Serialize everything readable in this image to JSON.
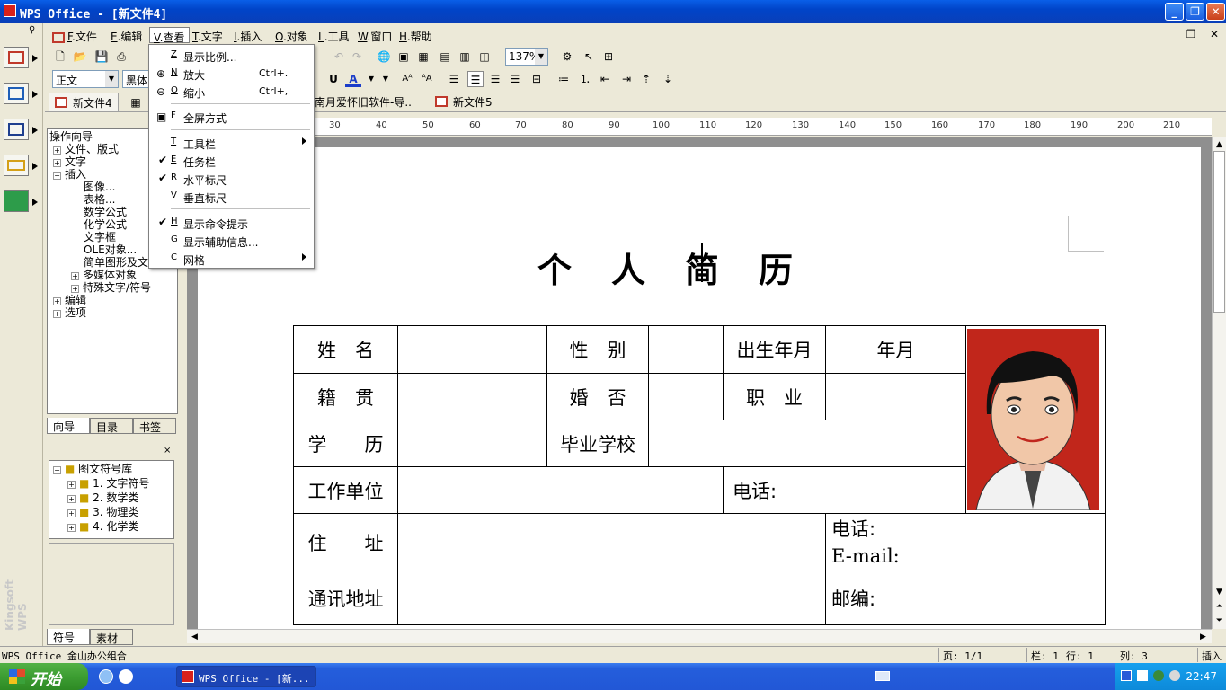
{
  "window": {
    "title": "WPS Office - [新文件4]",
    "minimize": "_",
    "maximize": "❐",
    "close": "✕"
  },
  "menubar": {
    "items": [
      {
        "key": "F",
        "label": "文件"
      },
      {
        "key": "E",
        "label": "编辑"
      },
      {
        "key": "V",
        "label": "查看"
      },
      {
        "key": "T",
        "label": "文字"
      },
      {
        "key": "I",
        "label": "插入"
      },
      {
        "key": "O",
        "label": "对象"
      },
      {
        "key": "L",
        "label": "工具"
      },
      {
        "key": "W",
        "label": "窗口"
      },
      {
        "key": "H",
        "label": "帮助"
      }
    ],
    "mdi": {
      "min": "_",
      "restore": "❐",
      "close": "✕"
    }
  },
  "toolbar": {
    "style_value": "正文",
    "font_value": "黑体",
    "zoom_value": "137%"
  },
  "doc_tabs": [
    "新文件4",
    "南月爱怀旧软件-导..",
    "新文件5"
  ],
  "view_menu": [
    {
      "key": "Z",
      "label": "显示比例...",
      "shortcut": ""
    },
    {
      "key": "N",
      "label": "放大",
      "shortcut": "Ctrl+."
    },
    {
      "key": "O",
      "label": "缩小",
      "shortcut": "Ctrl+,"
    },
    {
      "key": "F",
      "label": "全屏方式",
      "shortcut": ""
    },
    {
      "key": "T",
      "label": "工具栏",
      "shortcut": ""
    },
    {
      "key": "E",
      "label": "任务栏",
      "shortcut": "",
      "checked": true
    },
    {
      "key": "R",
      "label": "水平标尺",
      "shortcut": "",
      "checked": true
    },
    {
      "key": "V",
      "label": "垂直标尺",
      "shortcut": ""
    },
    {
      "key": "H",
      "label": "显示命令提示",
      "shortcut": "",
      "checked": true
    },
    {
      "key": "G",
      "label": "显示辅助信息...",
      "shortcut": ""
    },
    {
      "key": "C",
      "label": "网格",
      "shortcut": ""
    }
  ],
  "side_panel": {
    "tree": [
      "操作向导",
      "文件、版式",
      "文字",
      "插入",
      "图像...",
      "表格...",
      "数学公式",
      "化学公式",
      "文字框",
      "OLE对象...",
      "简单图形及文",
      "多媒体对象",
      "特殊文字/符号",
      "编辑",
      "选项"
    ],
    "tabs": [
      "向导",
      "目录",
      "书签"
    ],
    "symbols": [
      "图文符号库",
      "1. 文字符号",
      "2. 数学类",
      "3. 物理类",
      "4. 化学类"
    ],
    "bottom_tabs": [
      "符号库",
      "素材库"
    ],
    "brand": "Kingsoft WPS"
  },
  "ruler": [
    "30",
    "40",
    "50",
    "60",
    "70",
    "80",
    "90",
    "100",
    "110",
    "120",
    "130",
    "140",
    "150",
    "160",
    "170",
    "180",
    "190",
    "200",
    "210"
  ],
  "document": {
    "title": "个人简历",
    "rows": {
      "r1": [
        "姓　名",
        "性　别",
        "出生年月",
        "年月"
      ],
      "r2": [
        "籍　贯",
        "婚　否",
        "职　业"
      ],
      "r3": [
        "学　　历",
        "毕业学校"
      ],
      "r4": [
        "工作单位",
        "电话:"
      ],
      "r5": [
        "住　　址",
        "电话:",
        "E-mail:"
      ],
      "r6": [
        "通讯地址",
        "邮编:"
      ]
    }
  },
  "statusbar": {
    "app": "WPS Office 金山办公组合",
    "page": "页: 1/1",
    "column": "栏: 1",
    "line": "行: 1",
    "col": "列: 3",
    "mode": "插入"
  },
  "taskbar": {
    "start": "开始",
    "task": "WPS Office - [新...",
    "clock": "22:47"
  }
}
